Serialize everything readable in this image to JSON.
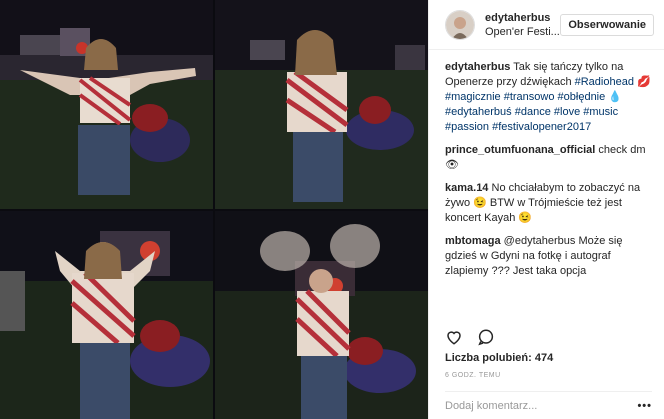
{
  "header": {
    "username": "edytaherbus",
    "location": "Open'er Festi...",
    "follow_label": "Obserwowanie"
  },
  "caption": {
    "user": "edytaherbus",
    "text_parts": [
      {
        "text": " Tak się tańczy tylko na Openerze przy dźwiękach ",
        "tag": false
      },
      {
        "text": "#Radiohead",
        "tag": true
      },
      {
        "text": " 💋",
        "tag": false
      },
      {
        "text": "#magicznie",
        "tag": true
      },
      {
        "text": " ",
        "tag": false
      },
      {
        "text": "#transowo",
        "tag": true
      },
      {
        "text": " ",
        "tag": false
      },
      {
        "text": "#obłędnie",
        "tag": true
      },
      {
        "text": " 💧",
        "tag": false
      },
      {
        "text": "#edytaherbuś",
        "tag": true
      },
      {
        "text": " ",
        "tag": false
      },
      {
        "text": "#dance",
        "tag": true
      },
      {
        "text": " ",
        "tag": false
      },
      {
        "text": "#love",
        "tag": true
      },
      {
        "text": " ",
        "tag": false
      },
      {
        "text": "#music",
        "tag": true
      },
      {
        "text": " ",
        "tag": false
      },
      {
        "text": "#passion",
        "tag": true
      },
      {
        "text": " ",
        "tag": false
      },
      {
        "text": "#festivalopener2017",
        "tag": true
      }
    ]
  },
  "comments": [
    {
      "user": "prince_otumfuonana_official",
      "text": " check dm👁"
    },
    {
      "user": "kama.14",
      "text": " No chciałabym to zobaczyć na żywo 😉 BTW w Trójmieście też jest koncert Kayah 😉"
    },
    {
      "user": "mbtomaga",
      "text": " @edytaherbus Może się gdzieś w Gdyni na fotkę i autograf zlapiemy ??? Jest taka opcja"
    }
  ],
  "likes_label": "Liczba polubień: 474",
  "timestamp": "6 GODZ. TEMU",
  "add_comment_placeholder": "Dodaj komentarz...",
  "more_label": "•••",
  "icons": {
    "like": "heart-icon",
    "comment": "comment-icon",
    "more": "more-icon"
  },
  "colors": {
    "hashtag": "#003569",
    "border": "#dbdbdb",
    "muted": "#999999"
  }
}
